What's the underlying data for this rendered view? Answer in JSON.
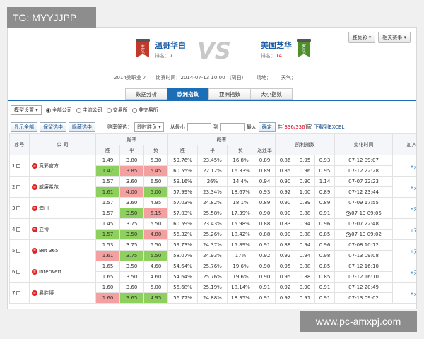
{
  "watermarks": {
    "top_left": "TG: MYYJJPP",
    "bottom_right": "www.pc-amxpj.com"
  },
  "top_buttons": [
    "胜负彩 ▾",
    "相关赛事 ▾"
  ],
  "match": {
    "home": {
      "flag_text": "主\n队",
      "name": "温哥华白",
      "rank_label": "排名：",
      "rank": "7"
    },
    "vs": "VS",
    "away": {
      "flag_text": "客\n队",
      "name": "美国芝华",
      "rank_label": "排名：",
      "rank": "14"
    },
    "info": [
      "2014美职业 7",
      "比赛时间：2014-07-13 10:00 （周日）",
      "场地：",
      "天气："
    ]
  },
  "tabs": [
    "数据分析",
    "欧洲指数",
    "亚洲指数",
    "大小指数"
  ],
  "active_tab": 1,
  "options": {
    "settings": "模型设置 ▾",
    "radios": [
      {
        "label": "全部公司",
        "on": true
      },
      {
        "label": "主流公司",
        "on": false
      },
      {
        "label": "交易所",
        "on": false
      },
      {
        "label": "非交易所",
        "on": false
      }
    ]
  },
  "tools": {
    "buttons": [
      "显示全部",
      "保留选中",
      "隐藏选中"
    ],
    "filter_label": "赔率筛选：",
    "filter_select": "即时胜负 ▾",
    "min_label": "从最小",
    "to_label": "到",
    "max_label": "最大",
    "confirm": "确定",
    "count_pre": "共[",
    "count": "336/336",
    "count_post": "]家",
    "download": "下载到EXCEL"
  },
  "headers": {
    "idx": "序号",
    "company": "公 司",
    "odds": "赔率",
    "prob": "概率",
    "kelly": "凯利指数",
    "time": "变化时间",
    "add": "加入对比",
    "sub_odds": [
      "胜",
      "平",
      "负"
    ],
    "sub_prob": [
      "胜",
      "平",
      "负",
      "返还率"
    ]
  },
  "rows": [
    {
      "idx": "1",
      "company": "竞彩官方",
      "lines": [
        {
          "odds": [
            "1.49",
            "3.80",
            "5.30"
          ],
          "prob": [
            "59.76%",
            "23.45%",
            "16.8%",
            "0.89"
          ],
          "kelly": [
            "0.86",
            "0.95",
            "0.93"
          ],
          "time": "07-12 09:07",
          "clock": false,
          "hl": [
            "",
            "",
            ""
          ],
          "redk": [
            false,
            false,
            false
          ]
        },
        {
          "odds": [
            "1.47",
            "3.85",
            "5.45"
          ],
          "prob": [
            "60.55%",
            "22.12%",
            "16.33%",
            "0.89"
          ],
          "kelly": [
            "0.85",
            "0.96",
            "0.95"
          ],
          "time": "07-12 22:28",
          "clock": false,
          "hl": [
            "g",
            "r",
            "r"
          ],
          "redk": [
            false,
            false,
            false
          ]
        }
      ],
      "add": "+对比"
    },
    {
      "idx": "2",
      "company": "威廉希尔",
      "lines": [
        {
          "odds": [
            "1.57",
            "3.60",
            "6.50"
          ],
          "prob": [
            "59.16%",
            "26%",
            "14.4%",
            "0.94"
          ],
          "kelly": [
            "0.90",
            "0.90",
            "1.14"
          ],
          "time": "07-07 22:23",
          "clock": false,
          "hl": [
            "",
            "",
            ""
          ],
          "redk": [
            false,
            false,
            false
          ]
        },
        {
          "odds": [
            "1.61",
            "4.00",
            "5.00"
          ],
          "prob": [
            "57.99%",
            "23.34%",
            "18.67%",
            "0.93"
          ],
          "kelly": [
            "0.92",
            "1.00",
            "0.89"
          ],
          "time": "07-12 23:44",
          "clock": false,
          "hl": [
            "g",
            "r",
            "g"
          ],
          "redk": [
            false,
            false,
            false
          ]
        }
      ],
      "add": "+对比"
    },
    {
      "idx": "3",
      "company": "澳门",
      "lines": [
        {
          "odds": [
            "1.57",
            "3.60",
            "4.95"
          ],
          "prob": [
            "57.03%",
            "24.82%",
            "18.1%",
            "0.89"
          ],
          "kelly": [
            "0.90",
            "0.89",
            "0.89"
          ],
          "time": "07-09 17:55",
          "clock": false,
          "hl": [
            "",
            "",
            ""
          ],
          "redk": [
            false,
            false,
            false
          ]
        },
        {
          "odds": [
            "1.57",
            "3.50",
            "5.15"
          ],
          "prob": [
            "57.03%",
            "25.58%",
            "17.39%",
            "0.90"
          ],
          "kelly": [
            "0.90",
            "0.88",
            "0.91"
          ],
          "time": "07-13 09:05",
          "clock": true,
          "hl": [
            "",
            "g",
            "r"
          ],
          "redk": [
            false,
            false,
            false
          ]
        }
      ],
      "add": "+对比"
    },
    {
      "idx": "4",
      "company": "立博",
      "lines": [
        {
          "odds": [
            "1.45",
            "3.75",
            "5.50"
          ],
          "prob": [
            "60.59%",
            "23.43%",
            "15.98%",
            "0.88"
          ],
          "kelly": [
            "0.83",
            "0.94",
            "0.96"
          ],
          "time": "07-07 22:48",
          "clock": false,
          "hl": [
            "",
            "",
            ""
          ],
          "redk": [
            false,
            false,
            false
          ]
        },
        {
          "odds": [
            "1.57",
            "3.50",
            "4.80"
          ],
          "prob": [
            "56.32%",
            "25.26%",
            "18.42%",
            "0.88"
          ],
          "kelly": [
            "0.90",
            "0.88",
            "0.85"
          ],
          "time": "07-13 09:02",
          "clock": true,
          "hl": [
            "g",
            "g",
            "r"
          ],
          "redk": [
            false,
            false,
            false
          ]
        }
      ],
      "add": "+对比"
    },
    {
      "idx": "5",
      "company": "Bet 365",
      "lines": [
        {
          "odds": [
            "1.53",
            "3.75",
            "5.50"
          ],
          "prob": [
            "59.73%",
            "24.37%",
            "15.89%",
            "0.91"
          ],
          "kelly": [
            "0.88",
            "0.94",
            "0.96"
          ],
          "time": "07-08 10:12",
          "clock": false,
          "hl": [
            "",
            "",
            ""
          ],
          "redk": [
            false,
            false,
            false
          ]
        },
        {
          "odds": [
            "1.61",
            "3.75",
            "5.50"
          ],
          "prob": [
            "58.07%",
            "24.93%",
            "17%",
            "0.92"
          ],
          "kelly": [
            "0.92",
            "0.94",
            "0.98"
          ],
          "time": "07-13 09:08",
          "clock": false,
          "hl": [
            "r",
            "g",
            "g"
          ],
          "redk": [
            false,
            false,
            false
          ]
        }
      ],
      "add": "+对比"
    },
    {
      "idx": "6",
      "company": "Interwett",
      "lines": [
        {
          "odds": [
            "1.65",
            "3.50",
            "4.60"
          ],
          "prob": [
            "54.64%",
            "25.76%",
            "19.6%",
            "0.90"
          ],
          "kelly": [
            "0.95",
            "0.88",
            "0.85"
          ],
          "time": "07-12 16:10",
          "clock": false,
          "hl": [
            "",
            "",
            ""
          ],
          "redk": [
            false,
            false,
            false
          ]
        },
        {
          "odds": [
            "1.65",
            "3.50",
            "4.60"
          ],
          "prob": [
            "54.64%",
            "25.76%",
            "19.6%",
            "0.90"
          ],
          "kelly": [
            "0.95",
            "0.88",
            "0.85"
          ],
          "time": "07-12 16:10",
          "clock": false,
          "hl": [
            "",
            "",
            ""
          ],
          "redk": [
            false,
            false,
            false
          ]
        }
      ],
      "add": "+对比"
    },
    {
      "idx": "7",
      "company": "易胜博",
      "lines": [
        {
          "odds": [
            "1.60",
            "3.60",
            "5.00"
          ],
          "prob": [
            "56.68%",
            "25.19%",
            "18.14%",
            "0.91"
          ],
          "kelly": [
            "0.92",
            "0.90",
            "0.91"
          ],
          "time": "07-12 20:49",
          "clock": false,
          "hl": [
            "",
            "",
            ""
          ],
          "redk": [
            false,
            false,
            false
          ]
        },
        {
          "odds": [
            "1.60",
            "3.65",
            "4.95"
          ],
          "prob": [
            "56.77%",
            "24.88%",
            "18.35%",
            "0.91"
          ],
          "kelly": [
            "0.92",
            "0.91",
            "0.91"
          ],
          "time": "07-13 09:02",
          "clock": false,
          "hl": [
            "r",
            "g",
            "g"
          ],
          "redk": [
            false,
            false,
            false
          ]
        }
      ],
      "add": "+对比"
    }
  ]
}
